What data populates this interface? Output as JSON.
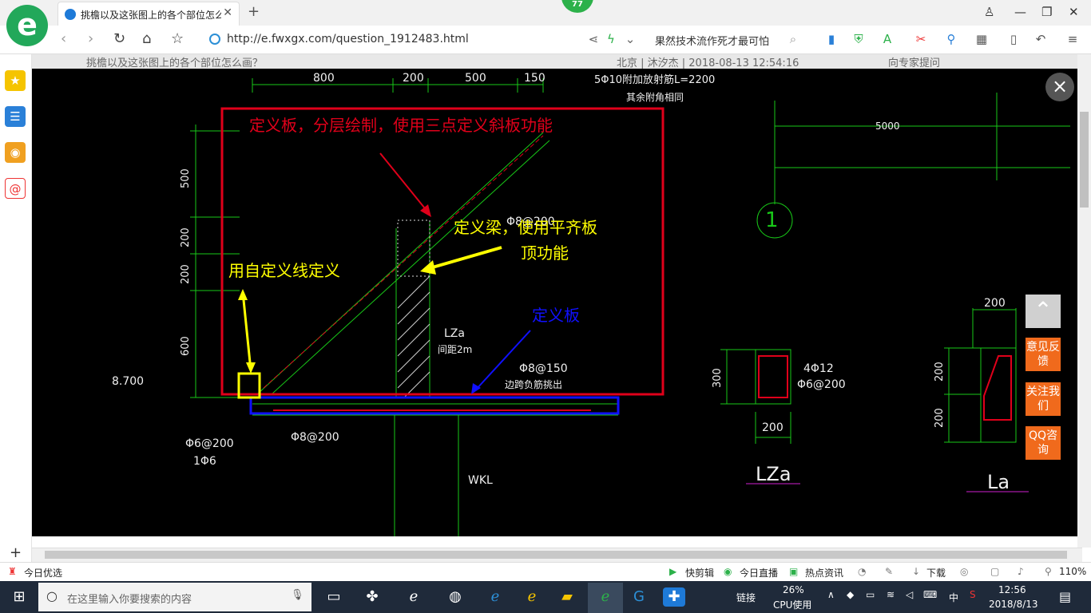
{
  "browser": {
    "badge_count": "77",
    "tab_title": "挑檐以及这张图上的各个部位怎么",
    "new_tab": "+",
    "url": "http://e.fwxgx.com/question_1912483.html",
    "search_hint": "果然技术流作死才最可怕",
    "window_buttons": [
      "minimize-icon",
      "restore-icon",
      "close-icon"
    ]
  },
  "page_header": {
    "title": "挑檐以及这张图上的各个部位怎么画？",
    "meta": "北京 | 沐汐杰 | 2018-08-13 12:54:16",
    "side_text": "向专家提问"
  },
  "viewer": {
    "close": "×",
    "dims_top": [
      "800",
      "200",
      "500",
      "150"
    ],
    "rebar_note_1": "5Φ10附加放射筋L=2200",
    "rebar_note_2": "其余附角相同",
    "dim_right": "5000",
    "axis_label": "1",
    "dims_left": [
      "500",
      "200",
      "200",
      "600"
    ],
    "elevation": "8.700",
    "ann_red": "定义板，分层绘制，使用三点定义斜板功能",
    "ann_beam_1": "定义梁，使用平齐板",
    "ann_beam_2": "顶功能",
    "ann_line": "用自定义线定义",
    "ann_blue": "定义板",
    "stair_label": "Φ8@200",
    "label_lza": "LZa",
    "label_spacing": "间距2m",
    "label_phi8_150": "Φ8@150",
    "label_edge": "边跨负筋挑出",
    "label_phi8_200": "Φ8@200",
    "label_phi6_200": "Φ6@200",
    "label_1phi6": "1Φ6",
    "label_wkl": "WKL",
    "label_b2": "Φ6@200",
    "section1": {
      "h": "300",
      "w": "200",
      "bar1": "4Φ12",
      "bar2": "Φ6@200",
      "name": "LZa"
    },
    "section2": {
      "w": "200",
      "h1": "200",
      "h2": "200",
      "name": "La"
    },
    "side_buttons": [
      "意见反馈",
      "关注我们",
      "QQ咨询"
    ]
  },
  "statusbar": {
    "left": "今日优选",
    "items": [
      "快剪辑",
      "今日直播",
      "热点资讯",
      "下载"
    ],
    "zoom": "110%"
  },
  "taskbar": {
    "search_placeholder": "在这里输入你要搜索的内容",
    "links": "链接",
    "cpu": "26%",
    "cpu_label": "CPU使用",
    "ime": "中",
    "time": "12:56",
    "date": "2018/8/13"
  },
  "colors": {
    "accent_green": "#22a85a",
    "cad_red": "#e0001a",
    "cad_blue": "#1010ff",
    "cad_yellow": "#ffff00",
    "cad_green": "#18c818",
    "feedback_orange": "#f06a1c"
  }
}
